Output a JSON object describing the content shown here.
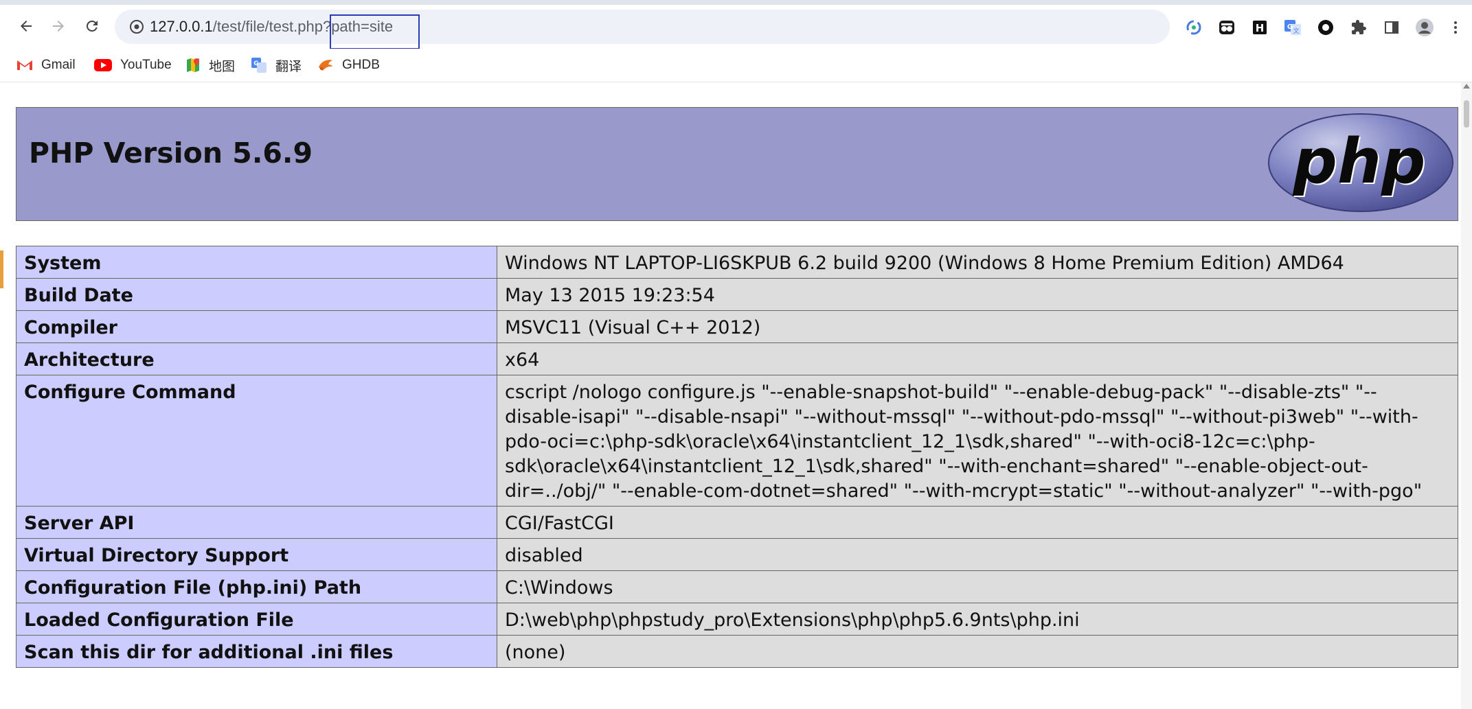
{
  "browser": {
    "url_host": "127.0.0.1",
    "url_path": "/test/file/test.php",
    "url_query": "?path=site",
    "bookmarks": [
      {
        "label": "Gmail",
        "icon": "gmail-icon"
      },
      {
        "label": "YouTube",
        "icon": "youtube-icon"
      },
      {
        "label": "地图",
        "icon": "maps-icon"
      },
      {
        "label": "翻译",
        "icon": "translate-icon"
      },
      {
        "label": "GHDB",
        "icon": "ghdb-icon"
      }
    ],
    "extensions": [
      "sync-icon",
      "spy-extension-icon",
      "h-extension-icon",
      "google-translate-icon",
      "circle-extension-icon",
      "puzzle-icon",
      "side-panel-icon",
      "profile-icon",
      "menu-icon"
    ]
  },
  "phpinfo": {
    "title": "PHP Version 5.6.9",
    "logo_text": "php",
    "rows": [
      {
        "label": "System",
        "value": "Windows NT LAPTOP-LI6SKPUB 6.2 build 9200 (Windows 8 Home Premium Edition) AMD64"
      },
      {
        "label": "Build Date",
        "value": "May 13 2015 19:23:54"
      },
      {
        "label": "Compiler",
        "value": "MSVC11 (Visual C++ 2012)"
      },
      {
        "label": "Architecture",
        "value": "x64"
      },
      {
        "label": "Configure Command",
        "value": "cscript /nologo configure.js \"--enable-snapshot-build\" \"--enable-debug-pack\" \"--disable-zts\" \"--disable-isapi\" \"--disable-nsapi\" \"--without-mssql\" \"--without-pdo-mssql\" \"--without-pi3web\" \"--with-pdo-oci=c:\\php-sdk\\oracle\\x64\\instantclient_12_1\\sdk,shared\" \"--with-oci8-12c=c:\\php-sdk\\oracle\\x64\\instantclient_12_1\\sdk,shared\" \"--with-enchant=shared\" \"--enable-object-out-dir=../obj/\" \"--enable-com-dotnet=shared\" \"--with-mcrypt=static\" \"--without-analyzer\" \"--with-pgo\""
      },
      {
        "label": "Server API",
        "value": "CGI/FastCGI"
      },
      {
        "label": "Virtual Directory Support",
        "value": "disabled"
      },
      {
        "label": "Configuration File (php.ini) Path",
        "value": "C:\\Windows"
      },
      {
        "label": "Loaded Configuration File",
        "value": "D:\\web\\php\\phpstudy_pro\\Extensions\\php\\php5.6.9nts\\php.ini"
      },
      {
        "label": "Scan this dir for additional .ini files",
        "value": "(none)"
      }
    ]
  },
  "colors": {
    "header_bg": "#9999cc",
    "label_cell_bg": "#ccccff",
    "value_cell_bg": "#dddddd",
    "url_highlight_border": "#2c3ab7"
  }
}
